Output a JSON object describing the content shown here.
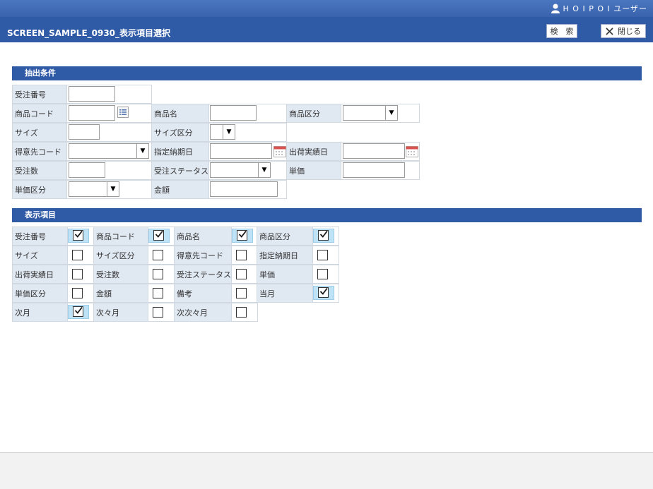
{
  "header": {
    "user_name": "H O I P O I ユーザー",
    "title": "SCREEN_SAMPLE_0930_表示項目選択",
    "search_button": "検　索",
    "close_button": "閉じる"
  },
  "conditions": {
    "section_title": "抽出条件",
    "labels": {
      "order_no": "受注番号",
      "product_code": "商品コード",
      "product_name": "商品名",
      "product_category": "商品区分",
      "size": "サイズ",
      "size_category": "サイズ区分",
      "customer_code": "得意先コード",
      "due_date": "指定納期日",
      "ship_date": "出荷実績日",
      "order_qty": "受注数",
      "order_status": "受注ステータス",
      "unit_price": "単価",
      "price_category": "単価区分",
      "amount": "金額"
    }
  },
  "display_items": {
    "section_title": "表示項目",
    "items": [
      {
        "label": "受注番号",
        "checked": true
      },
      {
        "label": "商品コード",
        "checked": true
      },
      {
        "label": "商品名",
        "checked": true
      },
      {
        "label": "商品区分",
        "checked": true
      },
      {
        "label": "サイズ",
        "checked": false
      },
      {
        "label": "サイズ区分",
        "checked": false
      },
      {
        "label": "得意先コード",
        "checked": false
      },
      {
        "label": "指定納期日",
        "checked": false
      },
      {
        "label": "出荷実績日",
        "checked": false
      },
      {
        "label": "受注数",
        "checked": false
      },
      {
        "label": "受注ステータス",
        "checked": false
      },
      {
        "label": "単価",
        "checked": false
      },
      {
        "label": "単価区分",
        "checked": false
      },
      {
        "label": "金額",
        "checked": false
      },
      {
        "label": "備考",
        "checked": false
      },
      {
        "label": "当月",
        "checked": true
      },
      {
        "label": "次月",
        "checked": true
      },
      {
        "label": "次々月",
        "checked": false
      },
      {
        "label": "次次々月",
        "checked": false
      }
    ]
  },
  "colors": {
    "header_bg": "#2f5aa6",
    "label_bg": "#e0e8f2",
    "checked_bg": "#bfe3f6"
  }
}
